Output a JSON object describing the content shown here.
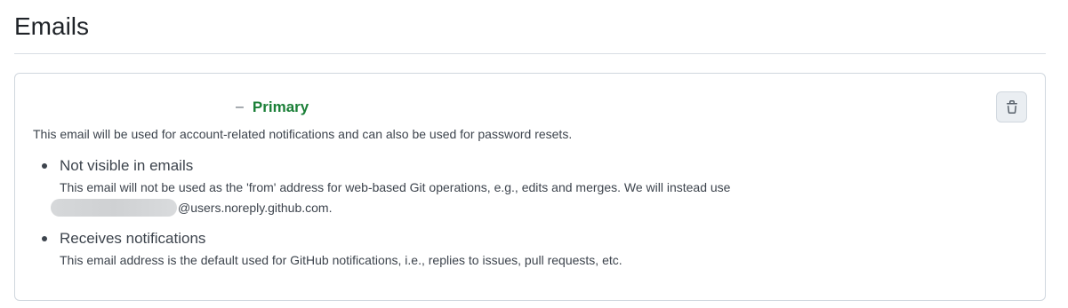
{
  "header": {
    "title": "Emails"
  },
  "email": {
    "address": "",
    "dash": "–",
    "primary_label": "Primary",
    "primary_description": "This email will be used for account-related notifications and can also be used for password resets.",
    "delete_icon": "trash-icon"
  },
  "settings": [
    {
      "title": "Not visible in emails",
      "description": "This email will not be used as the 'from' address for web-based Git operations, e.g., edits and merges. We will instead use",
      "noreply_suffix": "@users.noreply.github.com."
    },
    {
      "title": "Receives notifications",
      "description": "This email address is the default used for GitHub notifications, i.e., replies to issues, pull requests, etc."
    }
  ],
  "colors": {
    "primary_green": "#1a7f37",
    "border": "#d0d7de",
    "text": "#3d444d"
  }
}
